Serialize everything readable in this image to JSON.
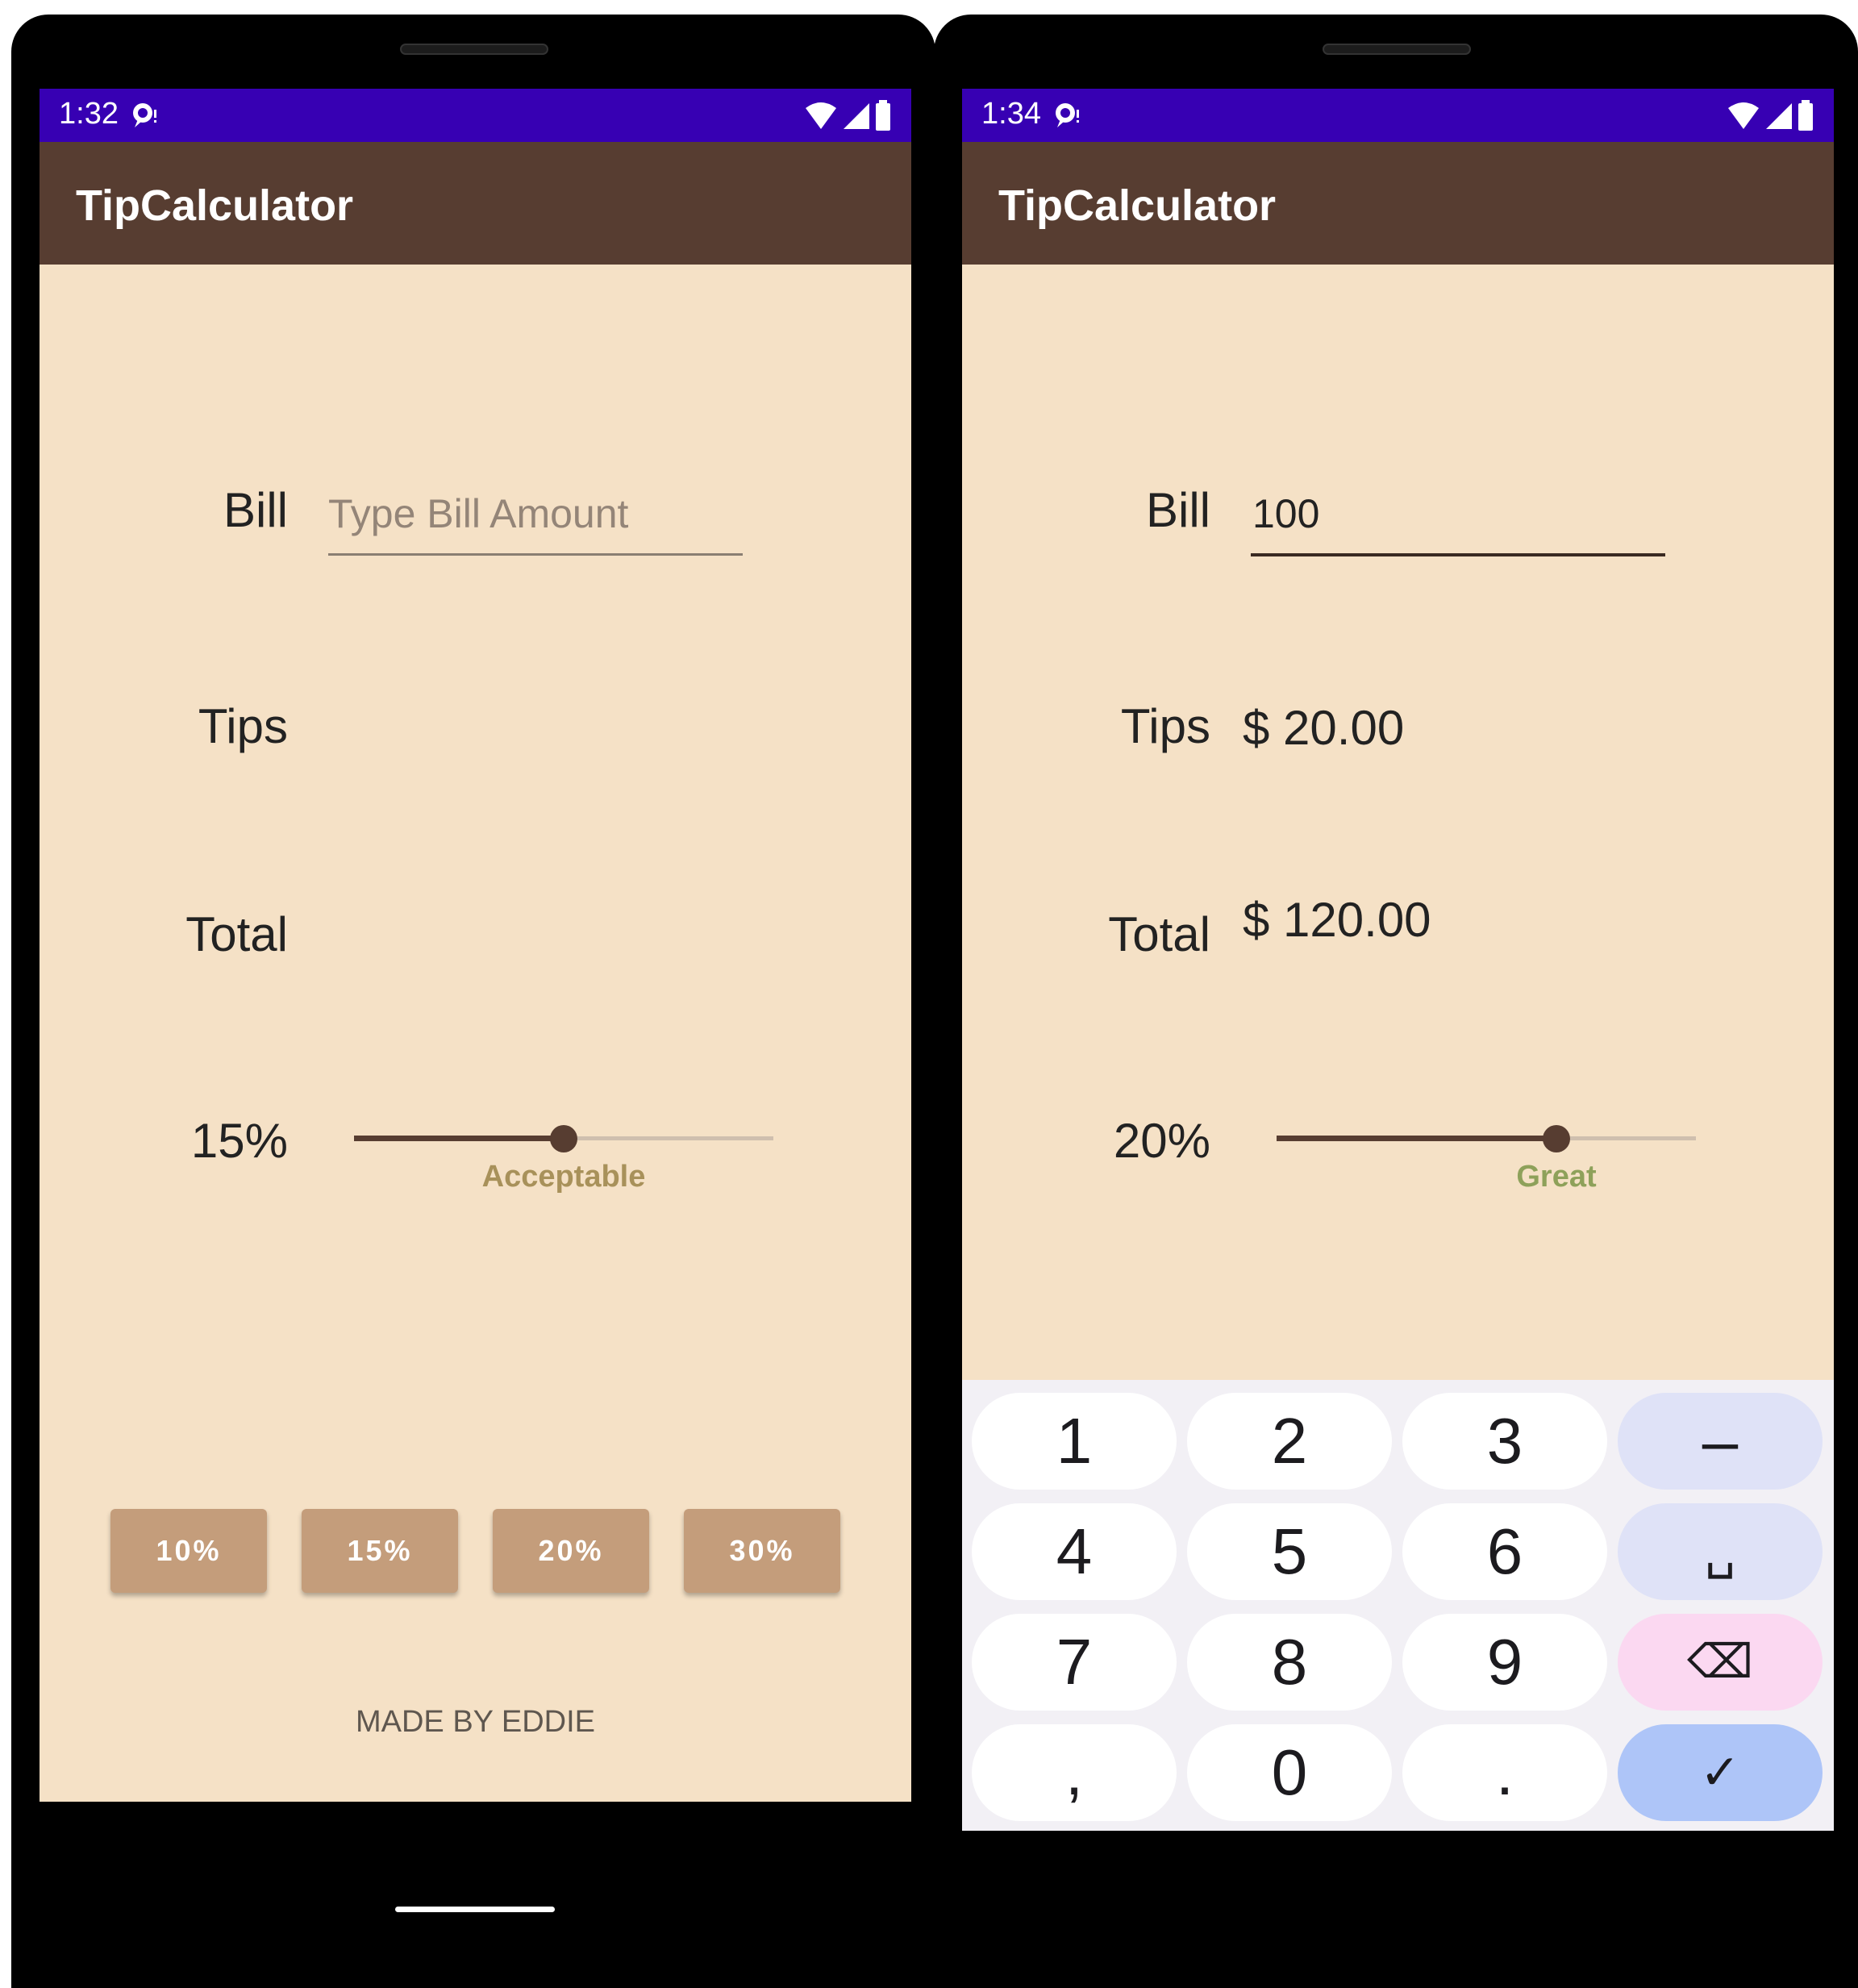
{
  "left": {
    "status": {
      "time": "1:32"
    },
    "app_title": "TipCalculator",
    "labels": {
      "bill": "Bill",
      "tips": "Tips",
      "total": "Total"
    },
    "bill_input": {
      "value": "",
      "placeholder": "Type Bill Amount"
    },
    "tip_percent_label": "15%",
    "slider": {
      "value_fraction": 0.5,
      "rating": "Acceptable",
      "rating_color": "#a8915a"
    },
    "tip_buttons": [
      "10%",
      "15%",
      "20%",
      "30%"
    ],
    "footer": "MADE BY EDDIE"
  },
  "right": {
    "status": {
      "time": "1:34"
    },
    "app_title": "TipCalculator",
    "labels": {
      "bill": "Bill",
      "tips": "Tips",
      "total": "Total"
    },
    "bill_input": {
      "value": "100",
      "placeholder": ""
    },
    "tips_value": "$ 20.00",
    "total_value": "$ 120.00",
    "tip_percent_label": "20%",
    "slider": {
      "value_fraction": 0.667,
      "rating": "Great",
      "rating_color": "#8ea15a"
    },
    "keyboard": {
      "keys": [
        "1",
        "2",
        "3",
        "–",
        "4",
        "5",
        "6",
        "␣",
        "7",
        "8",
        "9",
        "⌫",
        ",",
        "0",
        ".",
        "✓"
      ]
    }
  },
  "colors": {
    "status_bar": "#3700b3",
    "app_bar": "#573d31",
    "background": "#f5e1c6",
    "tip_button": "#c49d7b"
  }
}
